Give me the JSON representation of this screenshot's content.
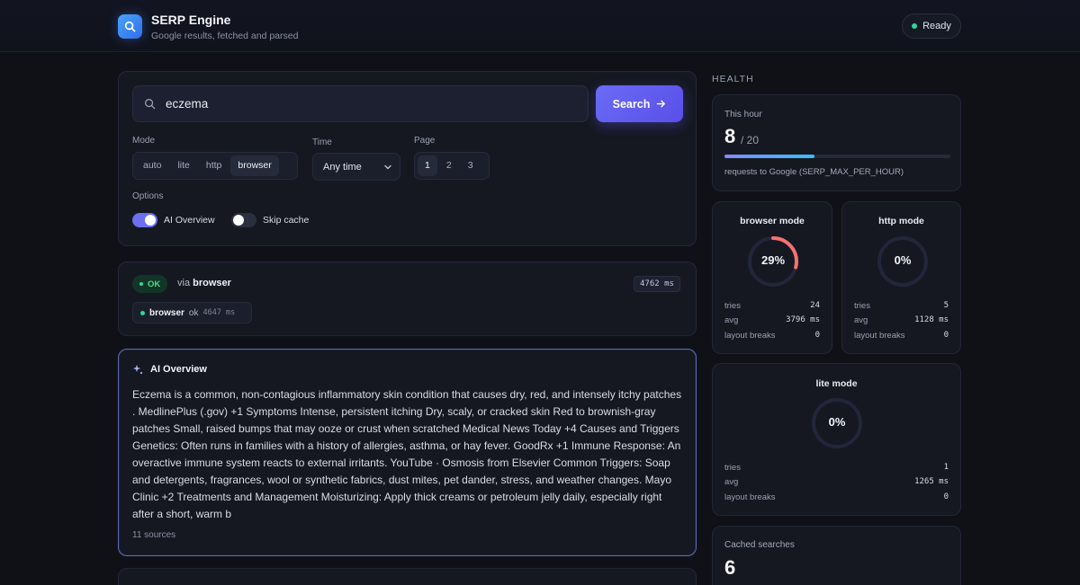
{
  "app": {
    "title": "SERP Engine",
    "subtitle": "Google results, fetched and parsed",
    "status": "Ready",
    "status_color": "#34d399"
  },
  "search": {
    "query": "eczema",
    "button_label": "Search",
    "mode_label": "Mode",
    "modes": [
      "auto",
      "lite",
      "http",
      "browser"
    ],
    "active_mode": "browser",
    "time_label": "Time",
    "time_value": "Any time",
    "page_label": "Page",
    "pages": [
      "1",
      "2",
      "3"
    ],
    "active_page": "1",
    "options_label": "Options",
    "options": [
      {
        "label": "AI Overview",
        "enabled": true
      },
      {
        "label": "Skip cache",
        "enabled": false
      }
    ]
  },
  "result_status": {
    "badge": "OK",
    "via_prefix": "via",
    "via_mode": "browser",
    "total_ms": "4762 ms",
    "attempt_mode": "browser",
    "attempt_status": "ok",
    "attempt_ms": "4647 ms"
  },
  "ai_overview": {
    "title": "AI Overview",
    "text": "Eczema is a common, non-contagious inflammatory skin condition that causes dry, red, and intensely itchy patches . MedlinePlus (.gov) +1 Symptoms Intense, persistent itching Dry, scaly, or cracked skin Red to brownish-gray patches Small, raised bumps that may ooze or crust when scratched Medical News Today +4 Causes and Triggers Genetics: Often runs in families with a history of allergies, asthma, or hay fever. GoodRx +1 Immune Response: An overactive immune system reacts to external irritants. YouTube · Osmosis from Elsevier Common Triggers: Soap and detergents, fragrances, wool or synthetic fabrics, dust mites, pet dander, stress, and weather changes. Mayo Clinic +2 Treatments and Management Moisturizing: Apply thick creams or petroleum jelly daily, especially right after a short, warm b",
    "sources": "11 sources"
  },
  "health": {
    "title": "HEALTH",
    "hour": {
      "label": "This hour",
      "count": "8",
      "limit": "/ 20",
      "fraction": 0.4,
      "caption": "requests to Google (SERP_MAX_PER_HOUR)"
    },
    "modes": [
      {
        "title": "browser mode",
        "percent": "29%",
        "fraction": 0.29,
        "color": "#f87171",
        "tries": "24",
        "avg": "3796 ms",
        "layout_breaks": "0"
      },
      {
        "title": "http mode",
        "percent": "0%",
        "fraction": 0,
        "color": "#f87171",
        "tries": "5",
        "avg": "1128 ms",
        "layout_breaks": "0"
      },
      {
        "title": "lite mode",
        "percent": "0%",
        "fraction": 0,
        "color": "#f87171",
        "tries": "1",
        "avg": "1265 ms",
        "layout_breaks": "0"
      }
    ],
    "stat_labels": {
      "tries": "tries",
      "avg": "avg",
      "layout_breaks": "layout breaks"
    },
    "cached": {
      "label": "Cached searches",
      "count": "6"
    }
  }
}
